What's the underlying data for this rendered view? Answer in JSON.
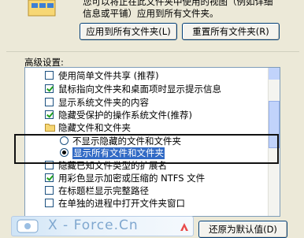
{
  "top": {
    "description_lines": [
      "您可以将正在此文件夹中使用的视图（例如详细",
      "信息或平铺）应用到所有文件夹。"
    ],
    "apply_all_label": "应用到所有文件夹(L)",
    "reset_all_label": "重置所有文件夹(R)"
  },
  "advanced": {
    "label": "高级设置:",
    "items": [
      {
        "type": "checkbox",
        "checked": false,
        "label": "使用简单文件共享 (推荐)"
      },
      {
        "type": "checkbox",
        "checked": true,
        "label": "鼠标指向文件夹和桌面项时显示提示信息"
      },
      {
        "type": "checkbox",
        "checked": false,
        "label": "显示系统文件夹的内容"
      },
      {
        "type": "checkbox",
        "checked": true,
        "label": "隐藏受保护的操作系统文件(推荐)"
      },
      {
        "type": "folder",
        "label": "隐藏文件和文件夹"
      },
      {
        "type": "radio",
        "selected": false,
        "label": "不显示隐藏的文件和文件夹"
      },
      {
        "type": "radio",
        "selected": true,
        "label": "显示所有文件和文件夹"
      },
      {
        "type": "checkbox",
        "checked": false,
        "label": "隐藏已知文件类型的扩展名"
      },
      {
        "type": "checkbox",
        "checked": true,
        "label": "用彩色显示加密或压缩的 NTFS 文件"
      },
      {
        "type": "checkbox",
        "checked": false,
        "label": "在标题栏显示完整路径"
      },
      {
        "type": "checkbox",
        "checked": false,
        "label": "在单独的进程中打开文件夹窗口"
      }
    ]
  },
  "restore_defaults_label": "还原为默认值(D)",
  "watermark": {
    "text": "X - Force.Cn"
  },
  "colors": {
    "selection": "#316ac5",
    "dialog_bg": "#ece9d8",
    "checkmark": "#21a121"
  }
}
